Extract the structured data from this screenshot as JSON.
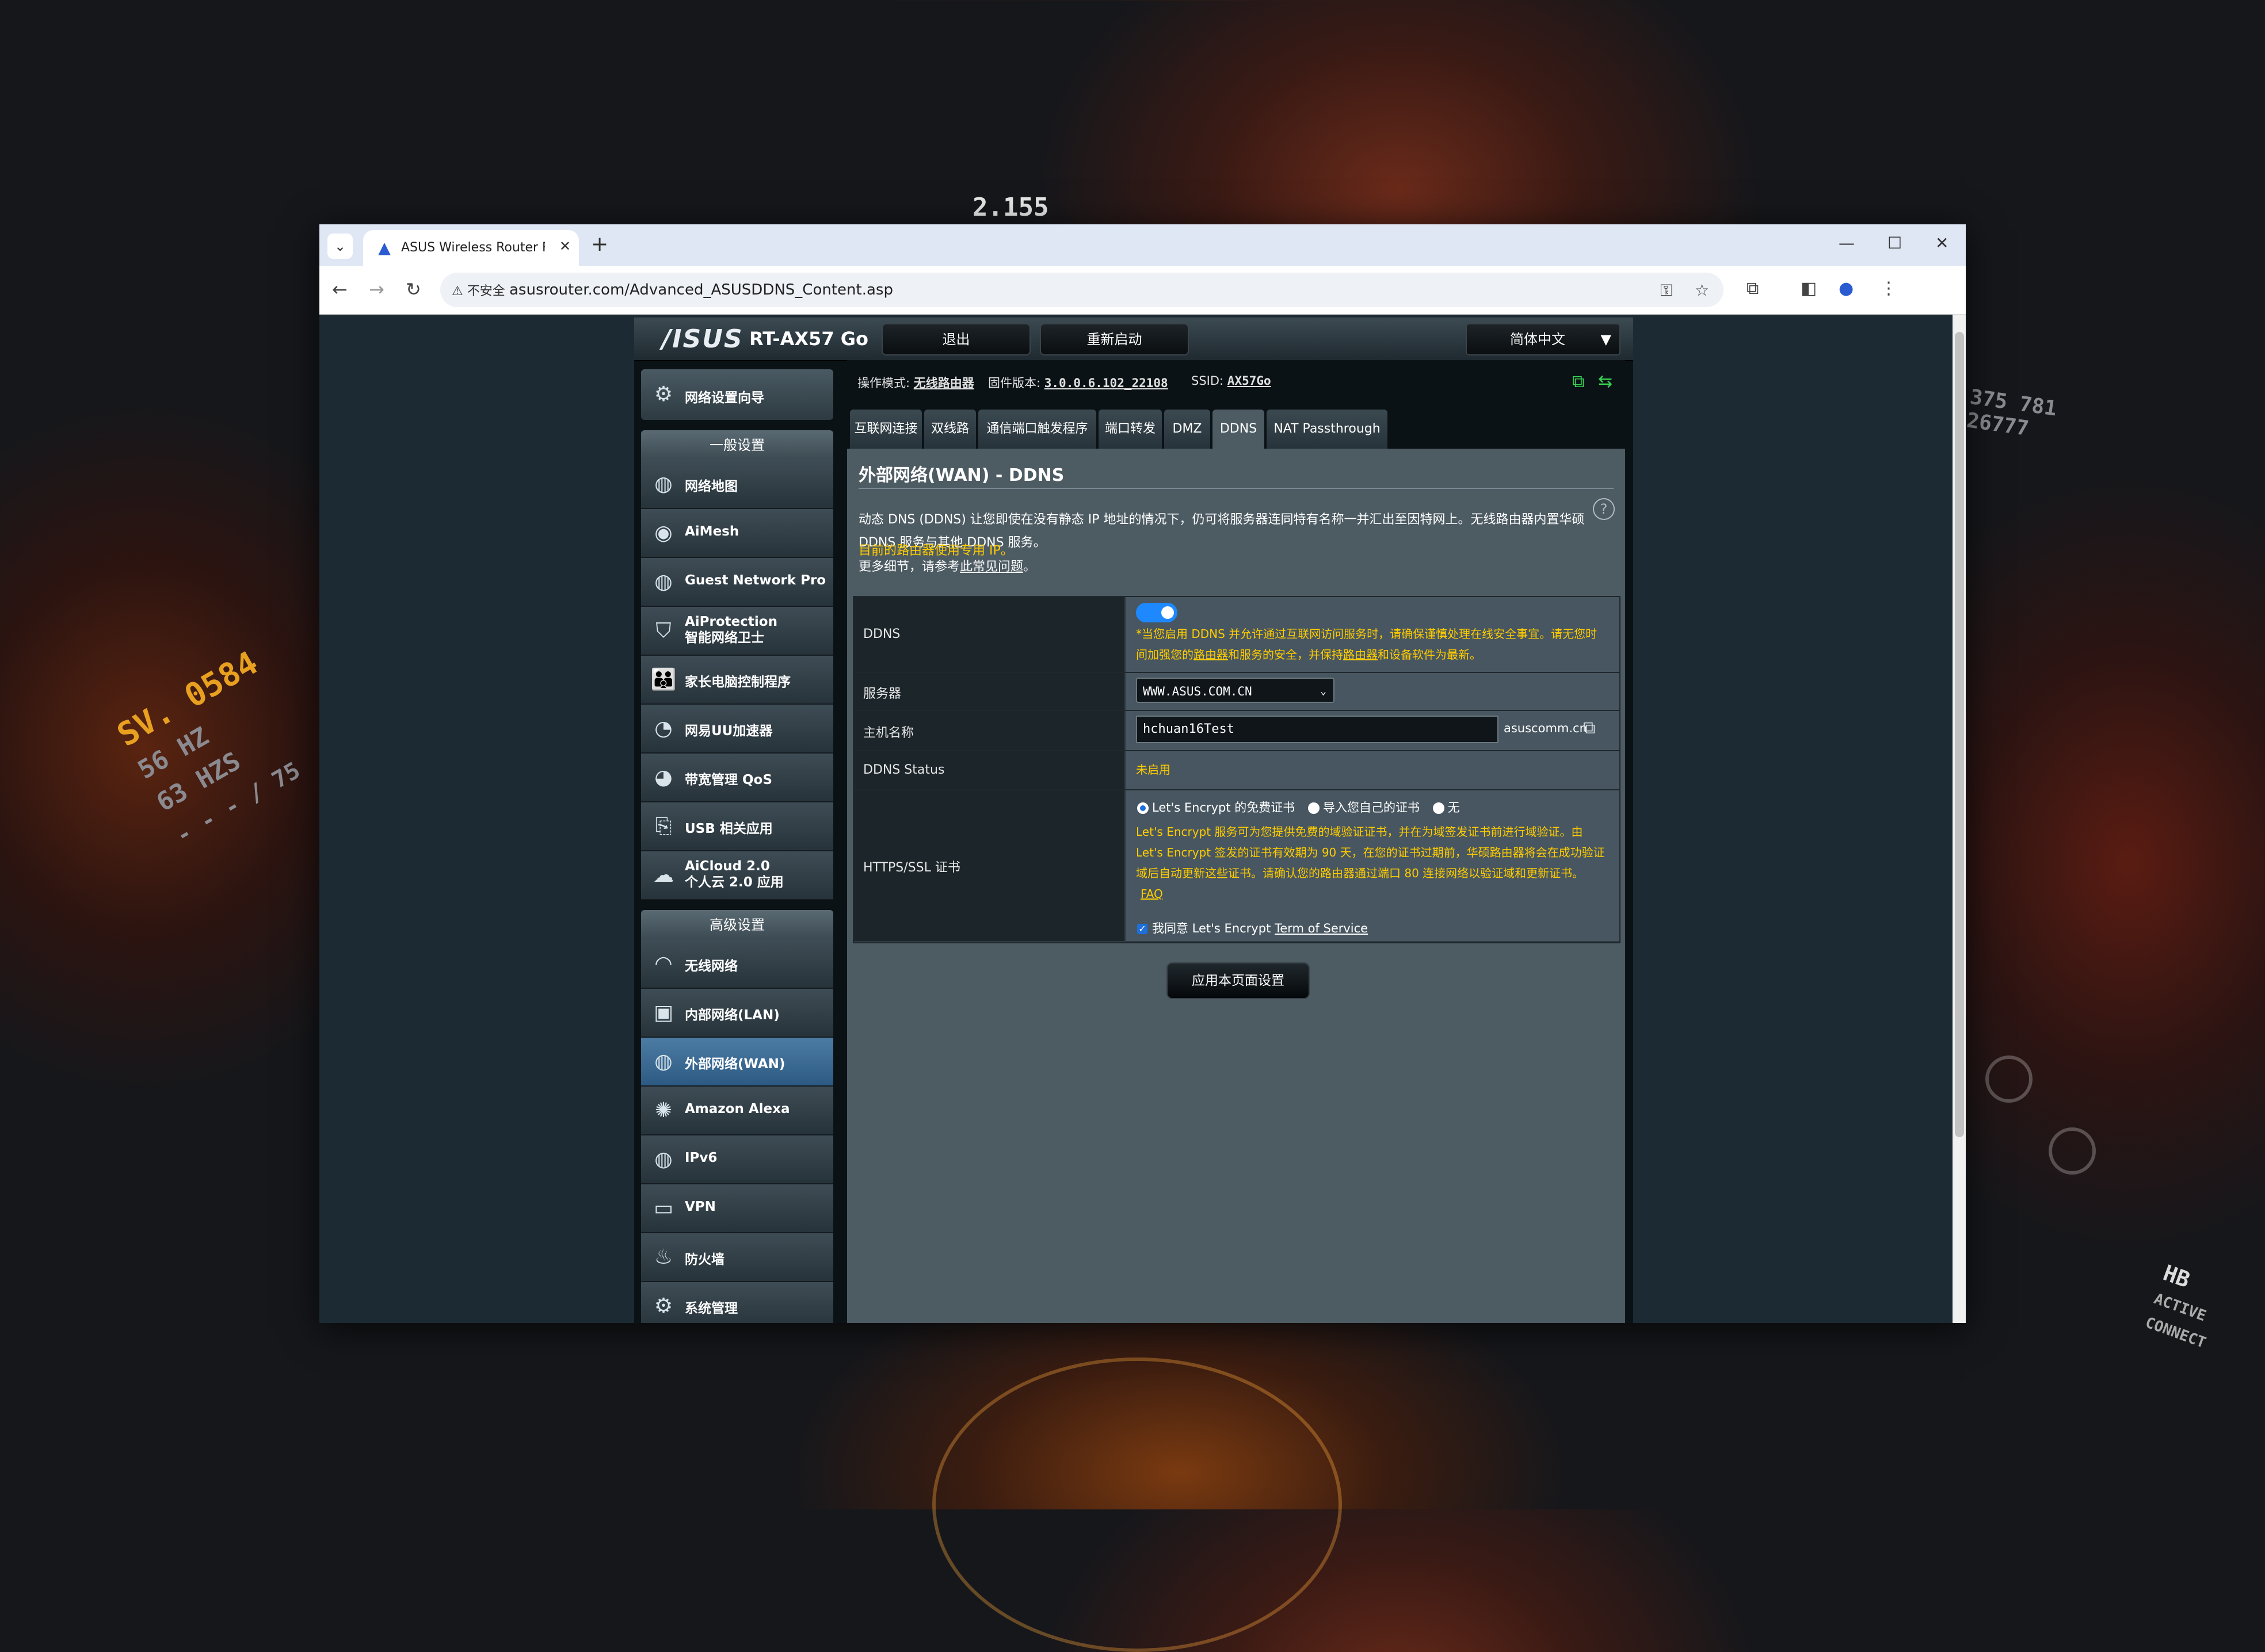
{
  "background": {
    "texts": [
      "2.155",
      "375 781",
      "26777",
      "SV. 0584",
      "56 HZ",
      "63 HZS",
      "- - - / 75",
      "HB",
      "ACTIVE CONNECT"
    ]
  },
  "browser": {
    "tab_title": "ASUS Wireless Router RT-AX",
    "new_tab": "+",
    "security_label": "不安全",
    "url": "asusrouter.com/Advanced_ASUSDDNS_Content.asp",
    "icons": [
      "tab-list-icon",
      "asus-favicon",
      "close-tab-icon",
      "minimize-icon",
      "maximize-icon",
      "close-window-icon",
      "back-icon",
      "forward-icon",
      "reload-icon",
      "warning-icon",
      "key-icon",
      "star-icon",
      "extensions-icon",
      "sidebar-icon",
      "profile-icon",
      "menu-icon"
    ]
  },
  "router": {
    "logo": "/ISUS",
    "model": "RT-AX57 Go",
    "logout": "退出",
    "reboot": "重新启动",
    "language": "简体中文",
    "status": {
      "mode_label": "操作模式:",
      "mode_value": "无线路由器",
      "firmware_label": "固件版本:",
      "firmware_value": "3.0.0.6.102_22108",
      "ssid_label": "SSID:",
      "ssid_value": "AX57Go"
    },
    "sidebar": {
      "wizard": "网络设置向导",
      "general_header": "一般设置",
      "general_items": [
        {
          "label": "网络地图",
          "icon": "globe-icon"
        },
        {
          "label": "AiMesh",
          "icon": "aimesh-icon"
        },
        {
          "label": "Guest Network Pro",
          "icon": "guest-network-icon"
        },
        {
          "label": "AiProtection",
          "label2": "智能网络卫士",
          "icon": "shield-icon"
        },
        {
          "label": "家长电脑控制程序",
          "icon": "parental-control-icon"
        },
        {
          "label": "网易UU加速器",
          "icon": "speed-icon"
        },
        {
          "label": "带宽管理 QoS",
          "icon": "gauge-icon"
        },
        {
          "label": "USB 相关应用",
          "icon": "usb-icon"
        },
        {
          "label": "AiCloud 2.0",
          "label2": "个人云 2.0 应用",
          "icon": "cloud-icon"
        }
      ],
      "advanced_header": "高级设置",
      "advanced_items": [
        {
          "label": "无线网络",
          "icon": "wireless-icon"
        },
        {
          "label": "内部网络(LAN)",
          "icon": "lan-icon"
        },
        {
          "label": "外部网络(WAN)",
          "icon": "wan-globe-icon",
          "active": true
        },
        {
          "label": "Amazon Alexa",
          "icon": "alexa-icon"
        },
        {
          "label": "IPv6",
          "icon": "ipv6-icon"
        },
        {
          "label": "VPN",
          "icon": "vpn-icon"
        },
        {
          "label": "防火墙",
          "icon": "firewall-icon"
        },
        {
          "label": "系统管理",
          "icon": "system-icon"
        }
      ]
    },
    "tabs": [
      "互联网连接",
      "双线路",
      "通信端口触发程序",
      "端口转发",
      "DMZ",
      "DDNS",
      "NAT Passthrough"
    ],
    "active_tab": "DDNS",
    "page_title": "外部网络(WAN) - DDNS",
    "description": "动态 DNS (DDNS) 让您即使在没有静态 IP 地址的情况下，仍可将服务器连同特有名称一并汇出至因特网上。无线路由器内置华硕 DDNS 服务与其他 DDNS 服务。",
    "ip_notice": "目前的路由器使用专用 IP。",
    "more_info_prefix": "更多细节，请参考",
    "faq_link": "此常见问题",
    "more_info_suffix": "。",
    "form": {
      "ddns_label": "DDNS",
      "ddns_enabled": true,
      "ddns_warning_1": "*当您启用 DDNS 并允许通过互联网访问服务时，请确保谨慎处理在线安全事宜。请无您时",
      "ddns_warning_2a": "间加强您的",
      "ddns_warning_router": "路由器",
      "ddns_warning_2b": "和服务的安全，并保持",
      "ddns_warning_2c": "和设备软件为最新。",
      "server_label": "服务器",
      "server_value": "WWW.ASUS.COM.CN",
      "hostname_label": "主机名称",
      "hostname_value": "hchuan16Test",
      "hostname_suffix": "asuscomm.cn",
      "status_label": "DDNS Status",
      "status_value": "未启用",
      "cert_label": "HTTPS/SSL 证书",
      "cert_options": [
        "Let's Encrypt 的免费证书",
        "导入您自己的证书",
        "无"
      ],
      "cert_selected": 0,
      "le_info": [
        "Let's Encrypt 服务可为您提供免费的域验证证书，并在为域签发证书前进行域验证。由",
        "Let's Encrypt 签发的证书有效期为 90 天，在您的证书过期前，华硕路由器将会在成功验证",
        "域后自动更新这些证书。请确认您的路由器通过端口 80 连接网络以验证域和更新证书。"
      ],
      "le_faq": "FAQ",
      "agree_prefix": "我同意 Let's Encrypt",
      "terms_link": "Term of Service",
      "agree_checked": true
    },
    "apply_button": "应用本页面设置"
  }
}
